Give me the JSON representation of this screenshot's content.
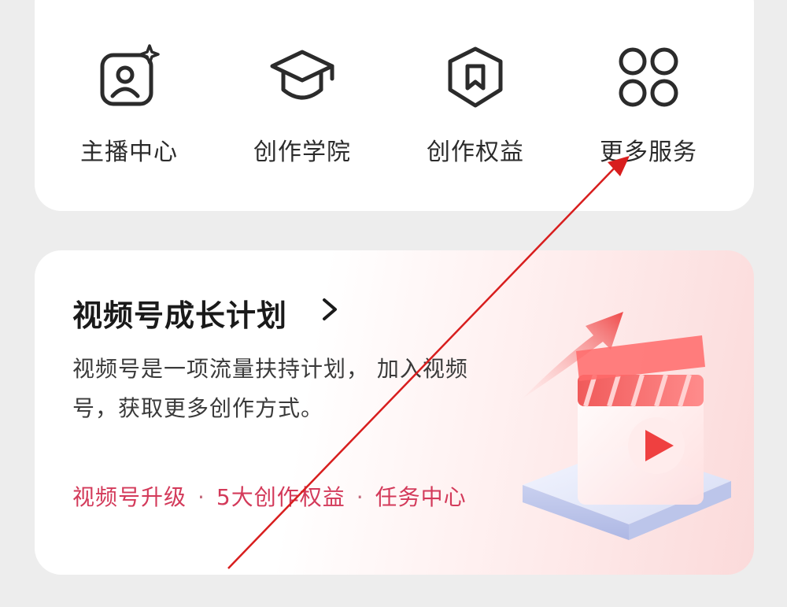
{
  "services": {
    "items": [
      {
        "label": "主播中心",
        "icon": "streamer-profile-icon"
      },
      {
        "label": "创作学院",
        "icon": "graduation-cap-icon"
      },
      {
        "label": "创作权益",
        "icon": "bookmark-shield-icon"
      },
      {
        "label": "更多服务",
        "icon": "grid-circles-icon"
      }
    ]
  },
  "growth": {
    "title": "视频号成长计划",
    "chevron_icon": "chevron-right-icon",
    "description": "视频号是一项流量扶持计划， 加入视频号，获取更多创作方式。",
    "links": [
      "视频号升级",
      "5大创作权益",
      "任务中心"
    ],
    "separator": "·",
    "illustration_icon": "video-growth-illustration"
  },
  "colors": {
    "link": "#d33a5a",
    "annotation_arrow": "#d81e1e",
    "background": "#ededed",
    "card": "#ffffff"
  }
}
